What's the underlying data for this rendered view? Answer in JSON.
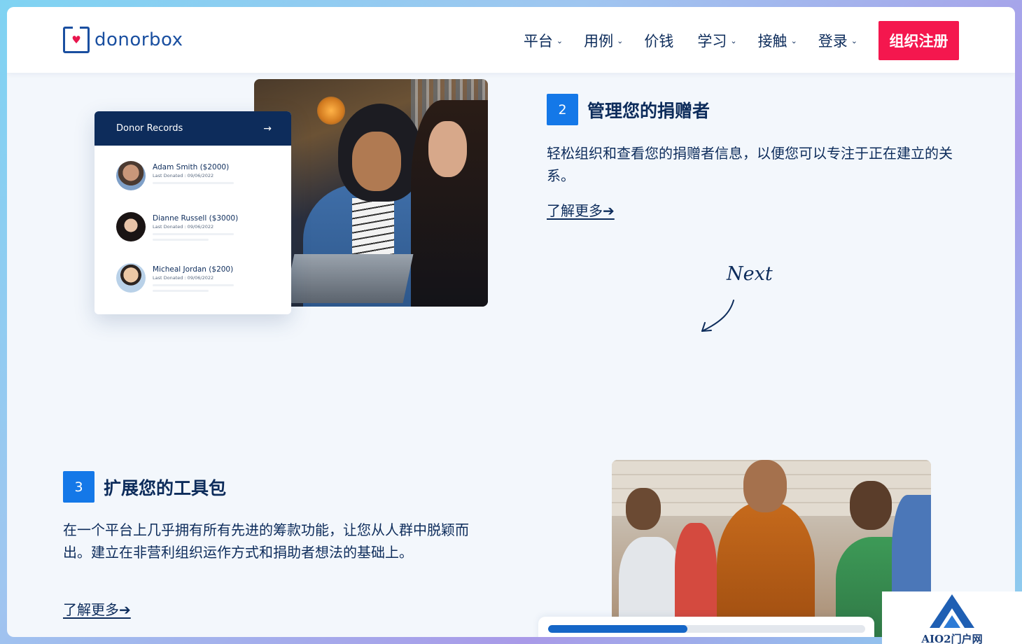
{
  "brand": {
    "name": "donorbox",
    "color": "#1a4fa0",
    "accent": "#e8164d"
  },
  "nav": {
    "items": [
      {
        "label": "平台",
        "has_dropdown": true
      },
      {
        "label": "用例",
        "has_dropdown": true
      },
      {
        "label": "价钱",
        "has_dropdown": false
      },
      {
        "label": "学习",
        "has_dropdown": true
      },
      {
        "label": "接触",
        "has_dropdown": true
      },
      {
        "label": "登录",
        "has_dropdown": true
      }
    ],
    "signup_label": "组织注册",
    "signup_color": "#f4174e"
  },
  "donor_card": {
    "title": "Donor Records",
    "arrow_icon": "arrow-right-icon",
    "rows": [
      {
        "name": "Adam Smith ($2000)",
        "date": "Last Donated : 09/06/2022"
      },
      {
        "name": "Dianne Russell ($3000)",
        "date": "Last Donated : 09/06/2022"
      },
      {
        "name": "Micheal Jordan ($200)",
        "date": "Last Donated : 09/06/2022"
      }
    ]
  },
  "step2": {
    "number": "2",
    "title": "管理您的捐赠者",
    "description": "轻松组织和查看您的捐赠者信息，以便您可以专注于正在建立的关系。",
    "link": "了解更多➔"
  },
  "next_hint": "Next",
  "step3": {
    "number": "3",
    "title": "扩展您的工具包",
    "description": "在一个平台上几乎拥有所有先进的筹款功能，让您从人群中脱颖而出。建立在非营利组织运作方式和捐助者想法的基础上。",
    "link": "了解更多➔"
  },
  "progress": {
    "fraction": 0.44,
    "color": "#1566c7"
  },
  "watermark": {
    "text": "AIO2门户网"
  }
}
